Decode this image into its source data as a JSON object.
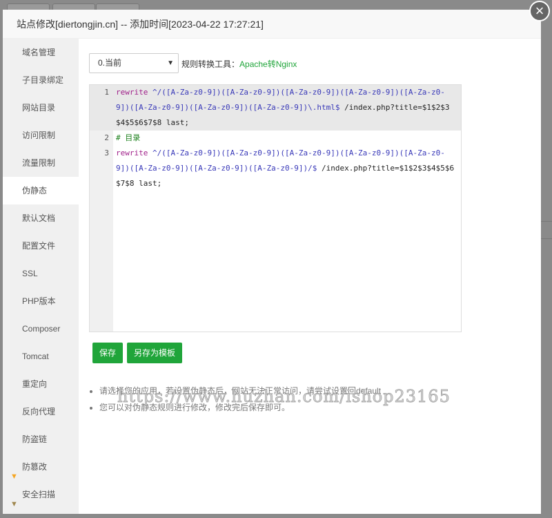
{
  "dialog": {
    "title": "站点修改[diertongjin.cn] -- 添加时间[2023-04-22 17:27:21]",
    "close_icon": "close-icon"
  },
  "sidebar": {
    "items": [
      {
        "label": "域名管理"
      },
      {
        "label": "子目录绑定"
      },
      {
        "label": "网站目录"
      },
      {
        "label": "访问限制"
      },
      {
        "label": "流量限制"
      },
      {
        "label": "伪静态",
        "active": true
      },
      {
        "label": "默认文档"
      },
      {
        "label": "配置文件"
      },
      {
        "label": "SSL"
      },
      {
        "label": "PHP版本"
      },
      {
        "label": "Composer"
      },
      {
        "label": "Tomcat"
      },
      {
        "label": "重定向"
      },
      {
        "label": "反向代理"
      },
      {
        "label": "防盗链"
      },
      {
        "label": "防篡改",
        "icon": "gem-icon",
        "icon_color": "#f5a623"
      },
      {
        "label": "安全扫描",
        "icon": "gem-icon",
        "icon_color": "#a08850"
      }
    ]
  },
  "main": {
    "template_select": "0.当前",
    "tool_label": "规则转换工具：",
    "tool_link": "Apache转Nginx",
    "code": [
      {
        "num": "1",
        "kw": "rewrite",
        "re": " ^/([A-Za-z0-9])([A-Za-z0-9])([A-Za-z0-9])([A-Za-z0-9])([A-Za-z0-9])([A-Za-z0-9])([A-Za-z0-9])([A-Za-z0-9])\\.html$",
        "tx": " /index.php?title=$1$2$3$4$5$6$7$8 last;"
      },
      {
        "num": "2",
        "cm": "# 目录"
      },
      {
        "num": "3",
        "kw": "rewrite",
        "re": " ^/([A-Za-z0-9])([A-Za-z0-9])([A-Za-z0-9])([A-Za-z0-9])([A-Za-z0-9])([A-Za-z0-9])([A-Za-z0-9])([A-Za-z0-9])/$",
        "tx": " /index.php?title=$1$2$3$4$5$6$7$8 last;"
      }
    ],
    "save_label": "保存",
    "save_template_label": "另存为模板",
    "tips": [
      "请选择您的应用，若设置伪静态后，网站无法正常访问，请尝试设置回default",
      "您可以对伪静态规则进行修改，修改完后保存即可。"
    ]
  },
  "watermark": "https://www.huzhan.com/ishop23165",
  "colors": {
    "accent": "#20a53a"
  }
}
